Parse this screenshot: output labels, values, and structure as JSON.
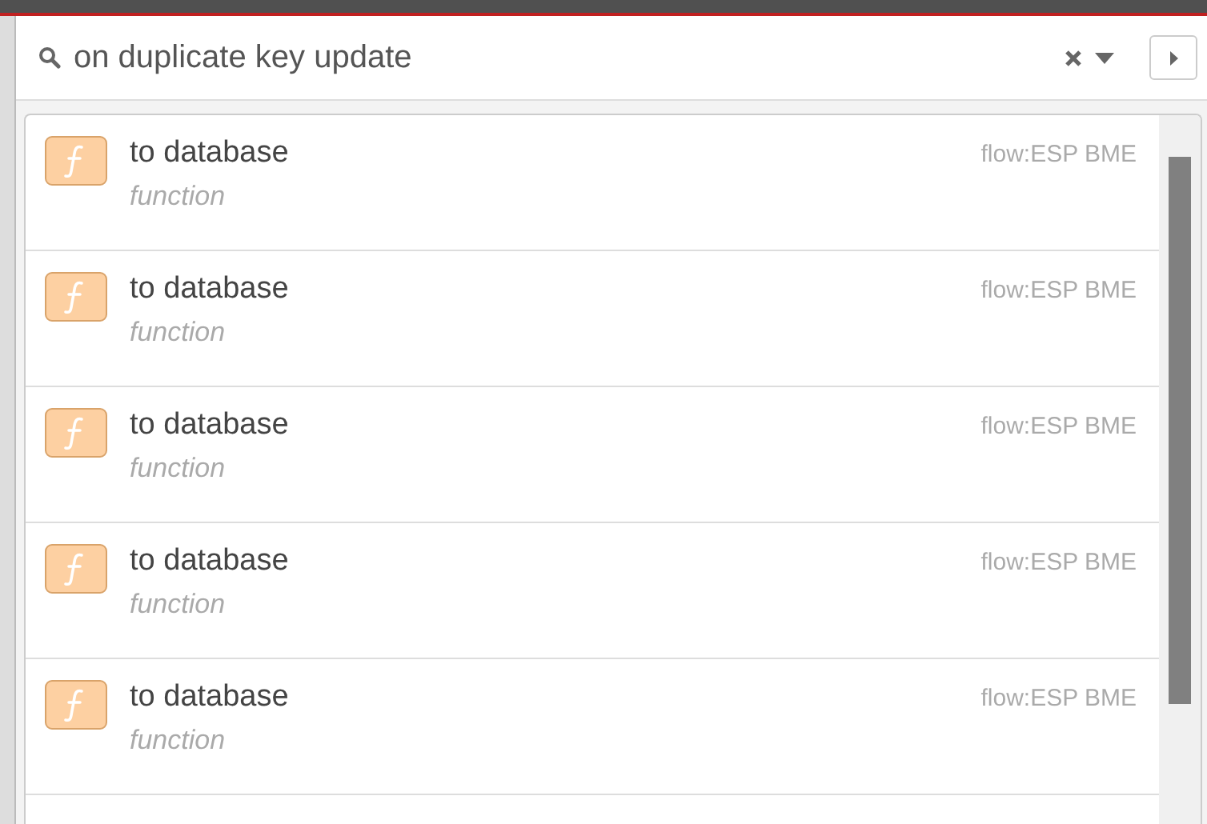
{
  "search": {
    "value": "on duplicate key update"
  },
  "results": [
    {
      "label": "to database",
      "type": "function",
      "flow": "flow:ESP BME"
    },
    {
      "label": "to database",
      "type": "function",
      "flow": "flow:ESP BME"
    },
    {
      "label": "to database",
      "type": "function",
      "flow": "flow:ESP BME"
    },
    {
      "label": "to database",
      "type": "function",
      "flow": "flow:ESP BME"
    },
    {
      "label": "to database",
      "type": "function",
      "flow": "flow:ESP BME"
    }
  ]
}
